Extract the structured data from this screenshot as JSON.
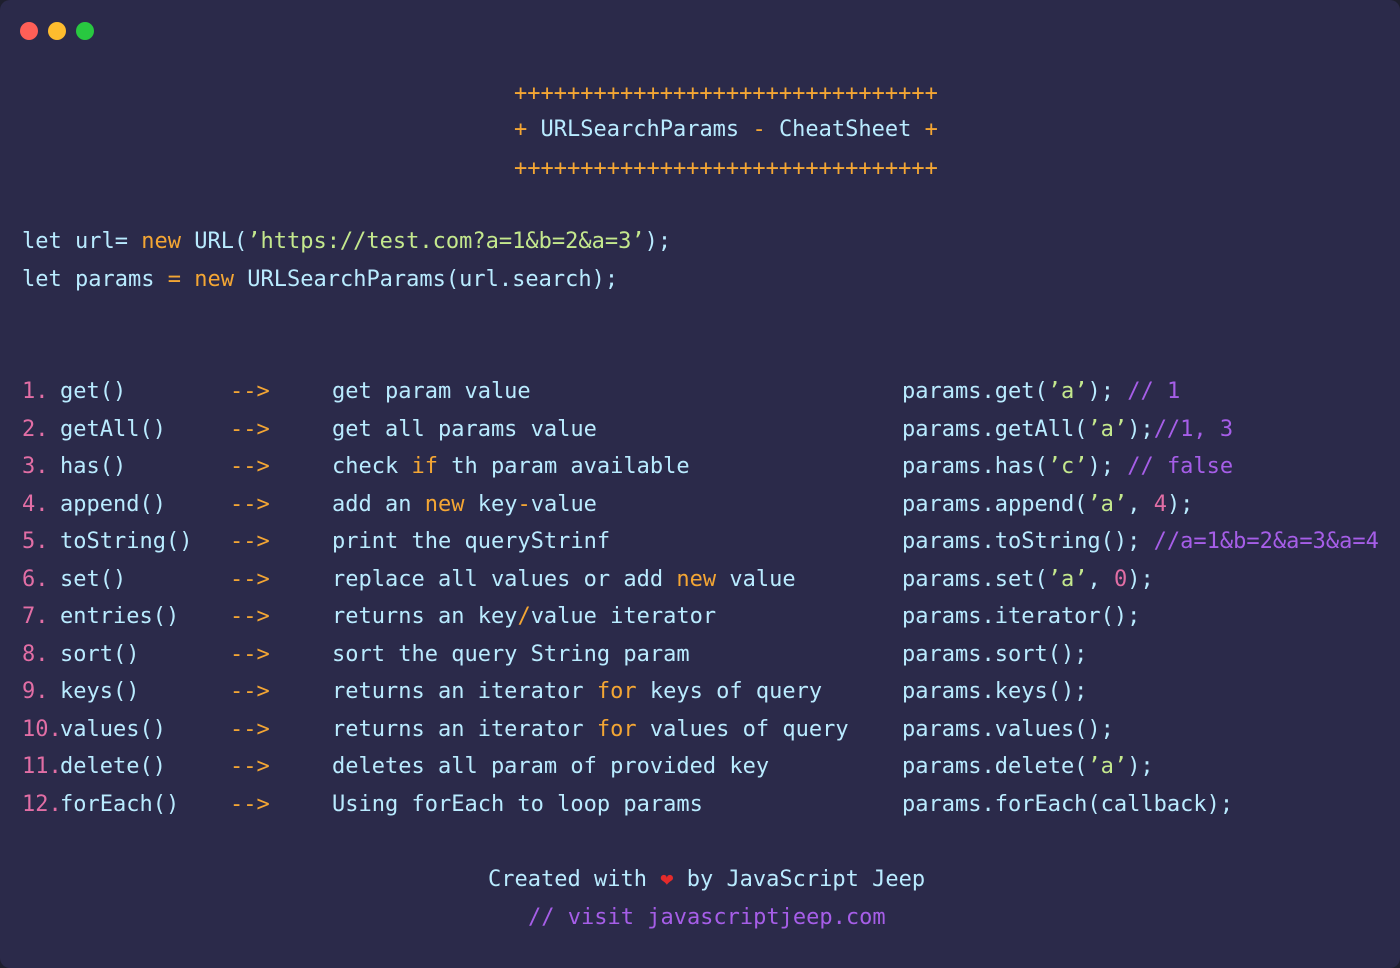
{
  "window": {
    "controls": [
      {
        "name": "close",
        "color": "#ff5f57"
      },
      {
        "name": "minimize",
        "color": "#febc2e"
      },
      {
        "name": "maximize",
        "color": "#28c840"
      }
    ]
  },
  "banner": {
    "border": "++++++++++++++++++++++++++++++++",
    "plus": "+",
    "title": "URLSearchParams",
    "dash": "-",
    "subtitle": "CheatSheet"
  },
  "setup": {
    "line1": {
      "kw_let": "let",
      "var": "url=",
      "kw_new": "new",
      "call": "URL(",
      "string": "’https://test.com?a=1&b=2&a=3’",
      "end": ");"
    },
    "line2": {
      "kw_let": "let",
      "var": "params",
      "eq": "=",
      "kw_new": "new",
      "call": "URLSearchParams(url.search);"
    }
  },
  "methods": [
    {
      "num": "1.",
      "name": "get()",
      "arrow": "-->",
      "desc": [
        {
          "t": "get param value"
        }
      ],
      "example": [
        {
          "t": "params.get("
        },
        {
          "t": "’a’",
          "c": "str"
        },
        {
          "t": "); "
        },
        {
          "t": "// 1",
          "c": "comment"
        }
      ]
    },
    {
      "num": "2.",
      "name": "getAll()",
      "arrow": "-->",
      "desc": [
        {
          "t": "get all params value"
        }
      ],
      "example": [
        {
          "t": "params.getAll("
        },
        {
          "t": "’a’",
          "c": "str"
        },
        {
          "t": ");"
        },
        {
          "t": "//1, 3",
          "c": "comment"
        }
      ]
    },
    {
      "num": "3.",
      "name": "has()",
      "arrow": "-->",
      "desc": [
        {
          "t": "check "
        },
        {
          "t": "if",
          "c": "kw"
        },
        {
          "t": " th param available"
        }
      ],
      "example": [
        {
          "t": "params.has("
        },
        {
          "t": "’c’",
          "c": "str"
        },
        {
          "t": "); "
        },
        {
          "t": "// false",
          "c": "comment"
        }
      ]
    },
    {
      "num": "4.",
      "name": "append()",
      "arrow": "-->",
      "desc": [
        {
          "t": "add an "
        },
        {
          "t": "new",
          "c": "kw"
        },
        {
          "t": " key"
        },
        {
          "t": "-",
          "c": "kw"
        },
        {
          "t": "value"
        }
      ],
      "example": [
        {
          "t": "params.append("
        },
        {
          "t": "’a’",
          "c": "str"
        },
        {
          "t": ", "
        },
        {
          "t": "4",
          "c": "num"
        },
        {
          "t": ");"
        }
      ]
    },
    {
      "num": "5.",
      "name": "toString()",
      "arrow": "-->",
      "desc": [
        {
          "t": "print the queryStrinf"
        }
      ],
      "example": [
        {
          "t": "params.toString(); "
        },
        {
          "t": "//a=1&b=2&a=3&a=4",
          "c": "comment"
        }
      ]
    },
    {
      "num": "6.",
      "name": "set()",
      "arrow": "-->",
      "desc": [
        {
          "t": "replace all values or add "
        },
        {
          "t": "new",
          "c": "kw"
        },
        {
          "t": " value"
        }
      ],
      "example": [
        {
          "t": "params.set("
        },
        {
          "t": "’a’",
          "c": "str"
        },
        {
          "t": ", "
        },
        {
          "t": "0",
          "c": "num"
        },
        {
          "t": ");"
        }
      ]
    },
    {
      "num": "7.",
      "name": "entries()",
      "arrow": "-->",
      "desc": [
        {
          "t": "returns an key"
        },
        {
          "t": "/",
          "c": "kw"
        },
        {
          "t": "value iterator"
        }
      ],
      "example": [
        {
          "t": "params.iterator();"
        }
      ]
    },
    {
      "num": "8.",
      "name": "sort()",
      "arrow": "-->",
      "desc": [
        {
          "t": "sort the query String param"
        }
      ],
      "example": [
        {
          "t": "params.sort();"
        }
      ]
    },
    {
      "num": "9.",
      "name": "keys()",
      "arrow": "-->",
      "desc": [
        {
          "t": "returns an iterator "
        },
        {
          "t": "for",
          "c": "kw"
        },
        {
          "t": " keys of query"
        }
      ],
      "example": [
        {
          "t": "params.keys();"
        }
      ]
    },
    {
      "num": "10.",
      "name": "values()",
      "arrow": "-->",
      "desc": [
        {
          "t": "returns an iterator "
        },
        {
          "t": "for",
          "c": "kw"
        },
        {
          "t": " values of query"
        }
      ],
      "example": [
        {
          "t": "params.values();"
        }
      ]
    },
    {
      "num": "11.",
      "name": "delete()",
      "arrow": "-->",
      "desc": [
        {
          "t": "deletes all param of provided key"
        }
      ],
      "example": [
        {
          "t": "params.delete("
        },
        {
          "t": "’a’",
          "c": "str"
        },
        {
          "t": ");"
        }
      ]
    },
    {
      "num": "12.",
      "name": "forEach()",
      "arrow": "-->",
      "desc": [
        {
          "t": "Using forEach to loop params"
        }
      ],
      "example": [
        {
          "t": "params.forEach(callback);"
        }
      ]
    }
  ],
  "footer": {
    "created": "Created with",
    "heart": "❤",
    "by": "by JavaScript Jeep",
    "visit": "// visit javascriptjeep.com"
  }
}
